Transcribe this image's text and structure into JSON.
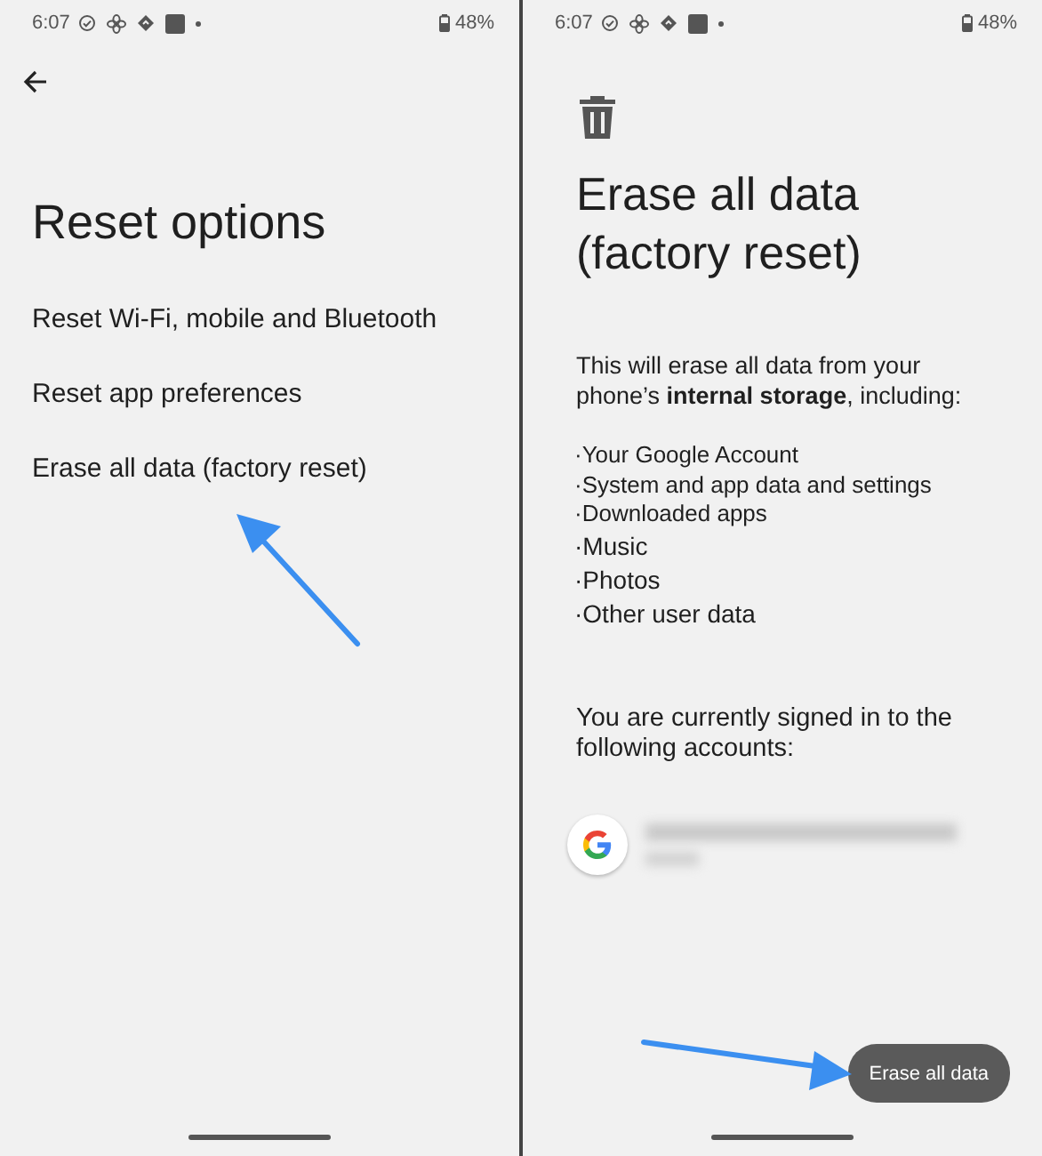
{
  "screens": [
    {
      "status_bar": {
        "time": "6:07",
        "battery": "48%"
      },
      "title": "Reset options",
      "options": [
        "Reset Wi-Fi, mobile and Bluetooth",
        "Reset app preferences",
        "Erase all data (factory reset)"
      ]
    },
    {
      "status_bar": {
        "time": "6:07",
        "battery": "48%"
      },
      "title": "Erase all data (factory reset)",
      "description": "This will erase all data from your phone’s **internal storage**, including:",
      "items": [
        "·Your Google Account",
        "·System and app data and settings",
        "·Downloaded apps",
        "·Music",
        "·Photos",
        "·Other user data"
      ],
      "accounts_text": "You are currently signed in to the following accounts:",
      "button": "Erase all data"
    }
  ]
}
